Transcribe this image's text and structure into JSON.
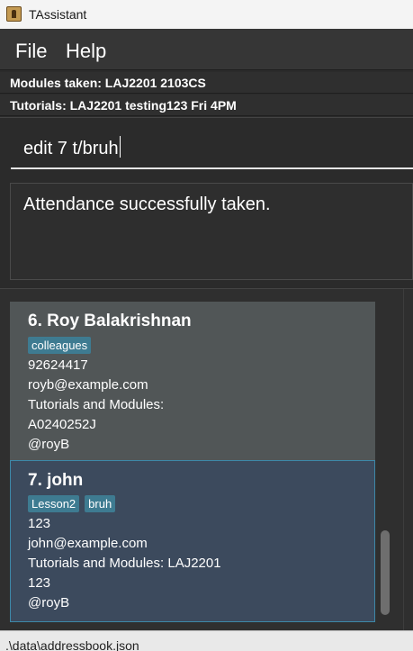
{
  "window": {
    "title": "TAssistant",
    "icon": "app-icon"
  },
  "menu": {
    "file": "File",
    "help": "Help"
  },
  "info": {
    "modules": "Modules taken: LAJ2201 2103CS",
    "tutorials": "Tutorials: LAJ2201 testing123 Fri 4PM"
  },
  "command": {
    "value": "edit 7 t/bruh"
  },
  "result": {
    "message": "Attendance successfully taken."
  },
  "persons": [
    {
      "name": "6.  Roy Balakrishnan",
      "tags": [
        "colleagues"
      ],
      "phone": "92624417",
      "email": "royb@example.com",
      "tutorials_label": "Tutorials and Modules:",
      "student_id": "A0240252J",
      "telegram": "@royB"
    },
    {
      "name": "7.  john",
      "tags": [
        "Lesson2",
        "bruh"
      ],
      "phone": "123",
      "email": "john@example.com",
      "tutorials_label": "Tutorials and Modules: LAJ2201",
      "student_id": "123",
      "telegram": "@royB"
    }
  ],
  "status": {
    "path": ".\\data\\addressbook.json"
  },
  "colors": {
    "selected_card": "#3c4a5d",
    "card": "#515657",
    "tag": "#3e7b91",
    "selected_border": "#3d88a8"
  }
}
